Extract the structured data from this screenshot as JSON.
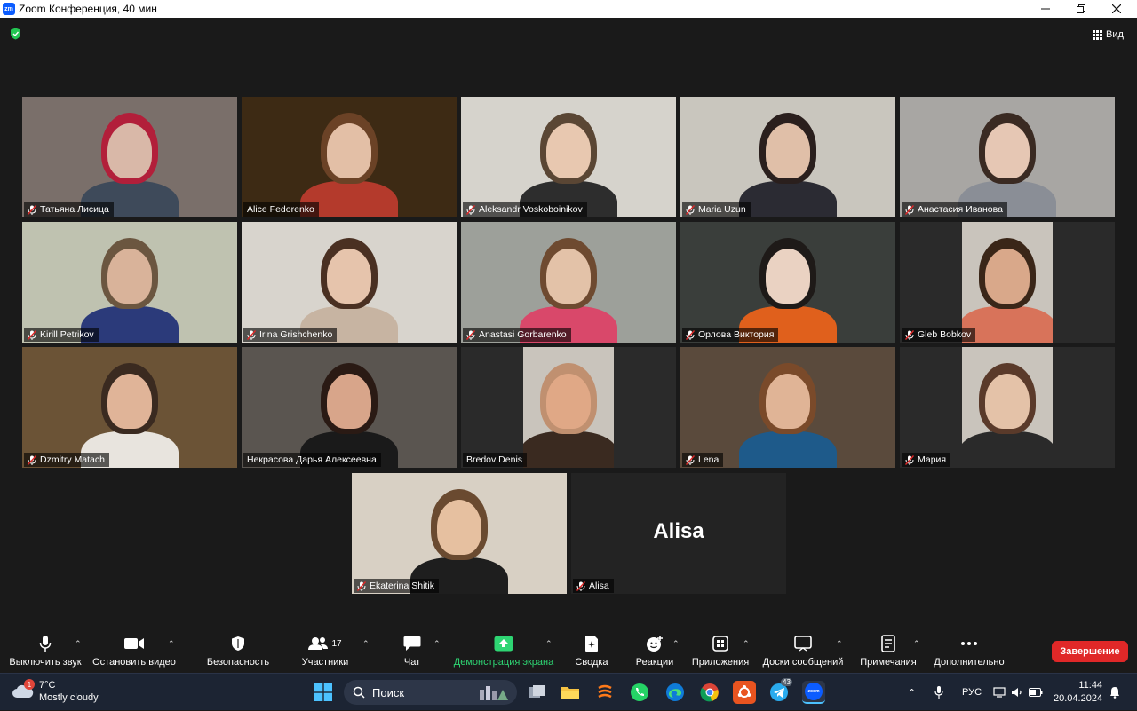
{
  "window": {
    "title": "Zoom Конференция, 40 мин",
    "logo_text": "zm"
  },
  "meeting": {
    "view_label": "Вид",
    "participants": [
      {
        "name": "Татьяна Лисица",
        "muted": true,
        "bg": "#7a6f6a",
        "skin": "#d9b8a8",
        "hair": "#b21f3a",
        "shirt": "#3e4a5a"
      },
      {
        "name": "Alice Fedorenko",
        "muted": false,
        "active": true,
        "bg": "#3d2a14",
        "skin": "#e3bfa6",
        "hair": "#6b4226",
        "shirt": "#b43a2c"
      },
      {
        "name": "Aleksandr Voskoboinikov",
        "muted": true,
        "bg": "#d6d3cc",
        "skin": "#e8c8b0",
        "hair": "#5a4634",
        "shirt": "#2d2d2d"
      },
      {
        "name": "Maria Uzun",
        "muted": true,
        "bg": "#c9c6be",
        "skin": "#e0bfa8",
        "hair": "#2a1f1d",
        "shirt": "#2b2b33"
      },
      {
        "name": "Анастасия Иванова",
        "muted": true,
        "bg": "#a8a6a3",
        "skin": "#e6c7b4",
        "hair": "#3a2a22",
        "shirt": "#8a8e96"
      },
      {
        "name": "Kirill Petrikov",
        "muted": true,
        "bg": "#bfc2b0",
        "skin": "#d9b39a",
        "hair": "#6b5640",
        "shirt": "#2b3a7a"
      },
      {
        "name": "Irina Grishchenko",
        "muted": true,
        "bg": "#d8d4cd",
        "skin": "#e6c4ac",
        "hair": "#4a3022",
        "shirt": "#c7b4a2"
      },
      {
        "name": "Anastasi Gorbarenko",
        "muted": true,
        "bg": "#9da09a",
        "skin": "#e3c2a8",
        "hair": "#6e4a30",
        "shirt": "#d9486a"
      },
      {
        "name": "Орлова Виктория",
        "muted": true,
        "bg": "#3a3e3b",
        "skin": "#ead2c2",
        "hair": "#1e1a18",
        "shirt": "#e0601c"
      },
      {
        "name": "Gleb Bobkov",
        "muted": true,
        "bg": "#2a2a2a",
        "skin": "#d9a88a",
        "hair": "#3a2618",
        "shirt": "#d8735a",
        "narrow": true
      },
      {
        "name": "Dzmitry Matach",
        "muted": true,
        "bg": "#6b5336",
        "skin": "#e0b498",
        "hair": "#3a2a20",
        "shirt": "#e8e4de"
      },
      {
        "name": "Некрасова Дарья Алексеевна",
        "muted": false,
        "bg": "#5a5550",
        "skin": "#d8a58a",
        "hair": "#2a1a14",
        "shirt": "#1a1a1a"
      },
      {
        "name": "Bredov Denis",
        "muted": false,
        "bg": "#2a2a2a",
        "skin": "#e0a886",
        "hair": "#c09070",
        "shirt": "#3a2a20",
        "narrow": true
      },
      {
        "name": "Lena",
        "muted": true,
        "bg": "#5a4a3c",
        "skin": "#e0b496",
        "hair": "#7a4a2a",
        "shirt": "#1e5a8a"
      },
      {
        "name": "Мария",
        "muted": true,
        "bg": "#2a2a2a",
        "skin": "#e4c2a8",
        "hair": "#5a3a2a",
        "shirt": "#2a2a2a",
        "narrow": true
      },
      {
        "name": "Ekaterina Shitik",
        "muted": true,
        "bg": "#d8d0c4",
        "skin": "#e6c0a0",
        "hair": "#6a4a30",
        "shirt": "#1e1e1e"
      },
      {
        "name": "Alisa",
        "muted": true,
        "no_video": true,
        "display_name": "Alisa"
      }
    ]
  },
  "toolbar": {
    "mute_label": "Выключить звук",
    "video_label": "Остановить видео",
    "security_label": "Безопасность",
    "participants_label": "Участники",
    "participants_count": "17",
    "chat_label": "Чат",
    "share_label": "Демонстрация экрана",
    "summary_label": "Сводка",
    "reactions_label": "Реакции",
    "apps_label": "Приложения",
    "whiteboards_label": "Доски сообщений",
    "notes_label": "Примечания",
    "more_label": "Дополнительно",
    "end_label": "Завершение",
    "accent_share": "#2ed573",
    "accent_end": "#e02828"
  },
  "taskbar": {
    "weather_temp": "7°C",
    "weather_desc": "Mostly cloudy",
    "weather_badge": "1",
    "search_placeholder": "Поиск",
    "language": "РУС",
    "time": "11:44",
    "date": "20.04.2024",
    "telegram_badge": "43",
    "zoom_app_text": "zoom"
  }
}
